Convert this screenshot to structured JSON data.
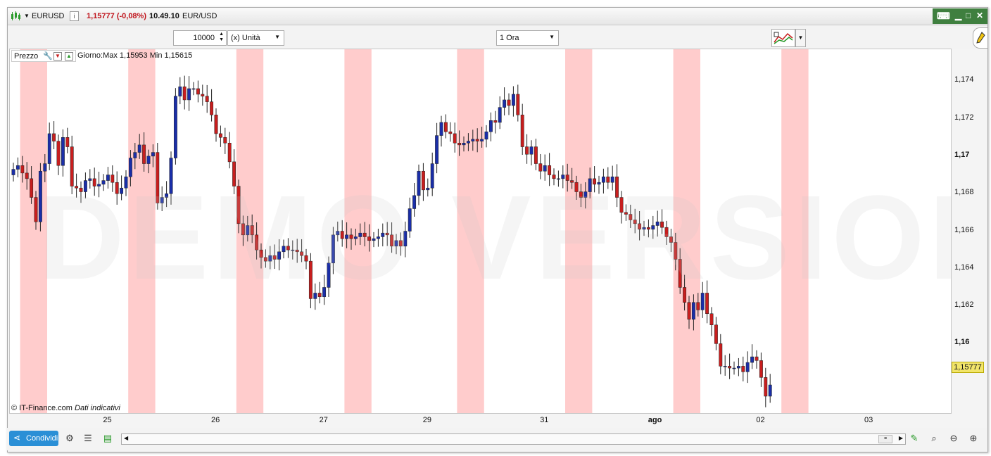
{
  "header": {
    "symbol": "EURUSD",
    "price_change": "1,15777 (-0,08%)",
    "time": "10.49.10",
    "pair": "EUR/USD"
  },
  "toolbar": {
    "quantity": "10000",
    "unit_select": "(x) Unità",
    "timeframe_select": "1 Ora"
  },
  "legend": {
    "label": "Prezzo",
    "day_info": "Giorno:Max 1,15953 Min 1,15615"
  },
  "copyright": "© IT-Finance.com",
  "copyright_note": "Dati indicativi",
  "watermark": "DEMO VERSION",
  "current_price_label": "1,15777",
  "bottom": {
    "share_label": "Condividi"
  },
  "colors": {
    "up": "#1a2ea8",
    "down": "#c81e1e",
    "session": "#ffcccc",
    "accent": "#2a8fd6"
  },
  "chart_data": {
    "type": "candlestick",
    "y_ticks": [
      {
        "label": "1,174",
        "value": 1.174,
        "bold": false
      },
      {
        "label": "1,172",
        "value": 1.172,
        "bold": false
      },
      {
        "label": "1,17",
        "value": 1.17,
        "bold": true
      },
      {
        "label": "1,168",
        "value": 1.168,
        "bold": false
      },
      {
        "label": "1,166",
        "value": 1.166,
        "bold": false
      },
      {
        "label": "1,164",
        "value": 1.164,
        "bold": false
      },
      {
        "label": "1,162",
        "value": 1.162,
        "bold": false
      },
      {
        "label": "1,16",
        "value": 1.16,
        "bold": true
      }
    ],
    "ylim": [
      1.1563,
      1.1757
    ],
    "x_ticks": [
      {
        "label": "25",
        "bold": false
      },
      {
        "label": "26",
        "bold": false
      },
      {
        "label": "27",
        "bold": false
      },
      {
        "label": "29",
        "bold": false
      },
      {
        "label": "31",
        "bold": false
      },
      {
        "label": "ago",
        "bold": true
      },
      {
        "label": "02",
        "bold": false
      },
      {
        "label": "03",
        "bold": false
      }
    ],
    "closes": [
      1.1693,
      1.1695,
      1.1691,
      1.1688,
      1.1678,
      1.1665,
      1.1692,
      1.1696,
      1.1712,
      1.1708,
      1.1695,
      1.171,
      1.1705,
      1.1684,
      1.1683,
      1.1681,
      1.1687,
      1.1688,
      1.1684,
      1.1685,
      1.1687,
      1.169,
      1.1686,
      1.168,
      1.1683,
      1.1689,
      1.1699,
      1.1702,
      1.1706,
      1.1696,
      1.17,
      1.1702,
      1.1675,
      1.1678,
      1.168,
      1.1699,
      1.1732,
      1.1737,
      1.173,
      1.1736,
      1.1736,
      1.1733,
      1.1732,
      1.1729,
      1.1722,
      1.1712,
      1.171,
      1.1707,
      1.1697,
      1.1684,
      1.1664,
      1.1658,
      1.1663,
      1.1658,
      1.165,
      1.1646,
      1.1644,
      1.1647,
      1.1645,
      1.1649,
      1.1652,
      1.165,
      1.165,
      1.1649,
      1.1647,
      1.1644,
      1.1624,
      1.1627,
      1.1625,
      1.163,
      1.1643,
      1.1658,
      1.166,
      1.1656,
      1.1658,
      1.1656,
      1.1657,
      1.1659,
      1.1657,
      1.1655,
      1.1656,
      1.1657,
      1.1659,
      1.1658,
      1.1652,
      1.1655,
      1.1652,
      1.166,
      1.1672,
      1.1679,
      1.1692,
      1.1682,
      1.1683,
      1.1696,
      1.1711,
      1.1718,
      1.1713,
      1.1712,
      1.1707,
      1.1706,
      1.1707,
      1.1708,
      1.1709,
      1.1708,
      1.1709,
      1.1713,
      1.1719,
      1.1718,
      1.1726,
      1.173,
      1.1727,
      1.1733,
      1.1722,
      1.1705,
      1.1701,
      1.1705,
      1.1696,
      1.1692,
      1.1695,
      1.169,
      1.1688,
      1.1688,
      1.169,
      1.1687,
      1.1686,
      1.1681,
      1.1678,
      1.1681,
      1.1688,
      1.1685,
      1.1686,
      1.1689,
      1.1686,
      1.1689,
      1.1678,
      1.167,
      1.1669,
      1.1666,
      1.1664,
      1.1661,
      1.1662,
      1.1661,
      1.1663,
      1.1665,
      1.1662,
      1.1657,
      1.1654,
      1.1645,
      1.163,
      1.1622,
      1.1613,
      1.1622,
      1.1618,
      1.1627,
      1.1616,
      1.161,
      1.16,
      1.1588,
      1.1588,
      1.1587,
      1.1587,
      1.1588,
      1.1585,
      1.159,
      1.1593,
      1.1591,
      1.1582,
      1.1572,
      1.1578
    ],
    "session_bands": [
      [
        1.5,
        7.5
      ],
      [
        25.5,
        31.5
      ],
      [
        49.5,
        55.5
      ],
      [
        73.5,
        79.5
      ],
      [
        98.5,
        104.5
      ],
      [
        122.5,
        128.5
      ],
      [
        146.5,
        152.5
      ],
      [
        170.5,
        176.5
      ]
    ]
  }
}
